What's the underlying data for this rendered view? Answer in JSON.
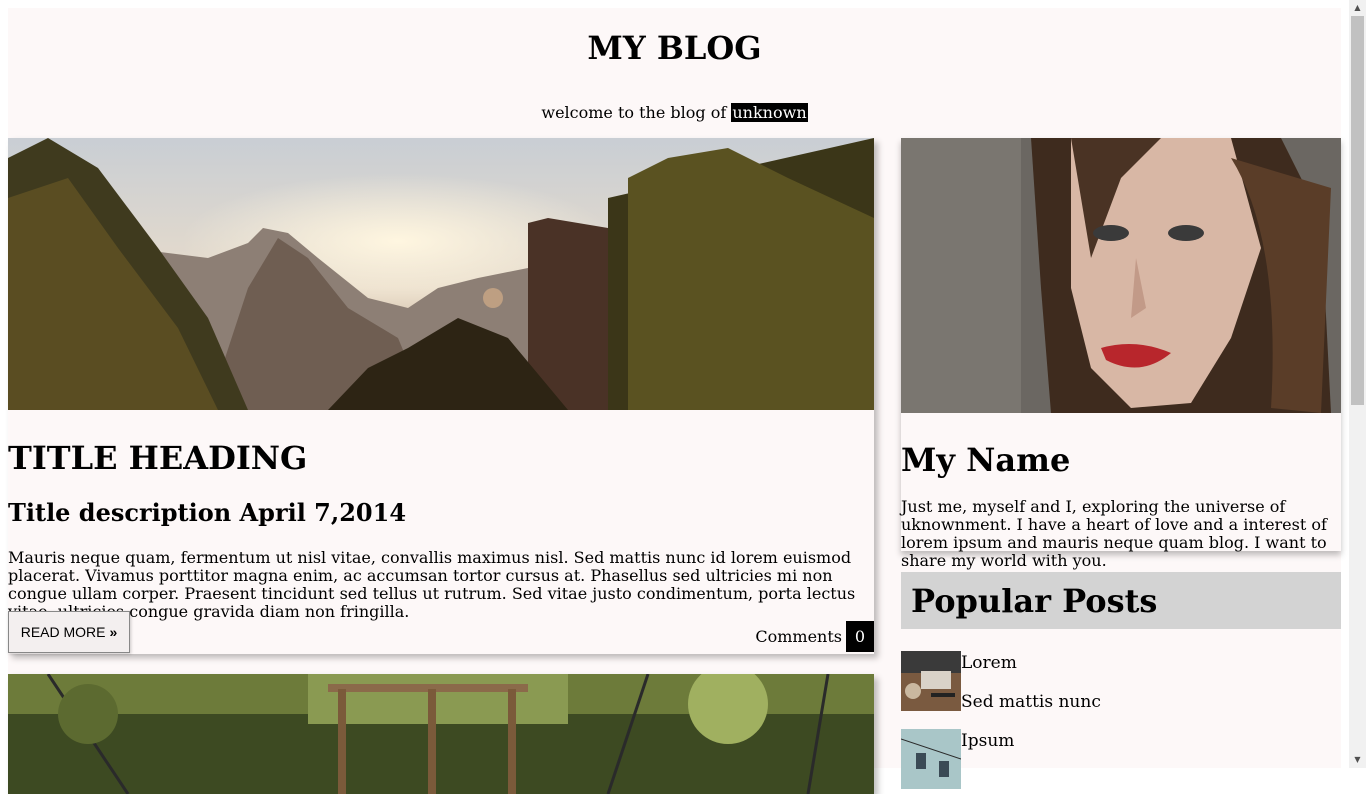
{
  "header": {
    "title": "MY BLOG",
    "welcome_prefix": "welcome to the blog of ",
    "welcome_highlight": "unknown"
  },
  "posts": [
    {
      "title": "TITLE HEADING",
      "subtitle": "Title description April 7,2014",
      "body": "Mauris neque quam, fermentum ut nisl vitae, convallis maximus nisl. Sed mattis nunc id lorem euismod placerat. Vivamus porttitor magna enim, ac accumsan tortor cursus at. Phasellus sed ultricies mi non congue ullam corper. Praesent tincidunt sed tellus ut rutrum. Sed vitae justo condimentum, porta lectus vitae, ultricies congue gravida diam non fringilla.",
      "read_more_label": "READ MORE",
      "read_more_icon": "double-chevron-right-icon",
      "comments_label": "Comments",
      "comments_count": "0"
    }
  ],
  "sidebar": {
    "profile_name": "My Name",
    "profile_bio": "Just me, myself and I, exploring the universe of uknownment. I have a heart of love and a interest of lorem ipsum and mauris neque quam blog. I want to share my world with you.",
    "popular_heading": "Popular Posts",
    "popular_posts": [
      {
        "title": "Lorem",
        "desc": "Sed mattis nunc"
      },
      {
        "title": "Ipsum",
        "desc": ""
      }
    ]
  },
  "colors": {
    "page_bg": "#fdf8f8",
    "popular_header_bg": "#d3d3d3",
    "badge_bg": "#000000"
  }
}
